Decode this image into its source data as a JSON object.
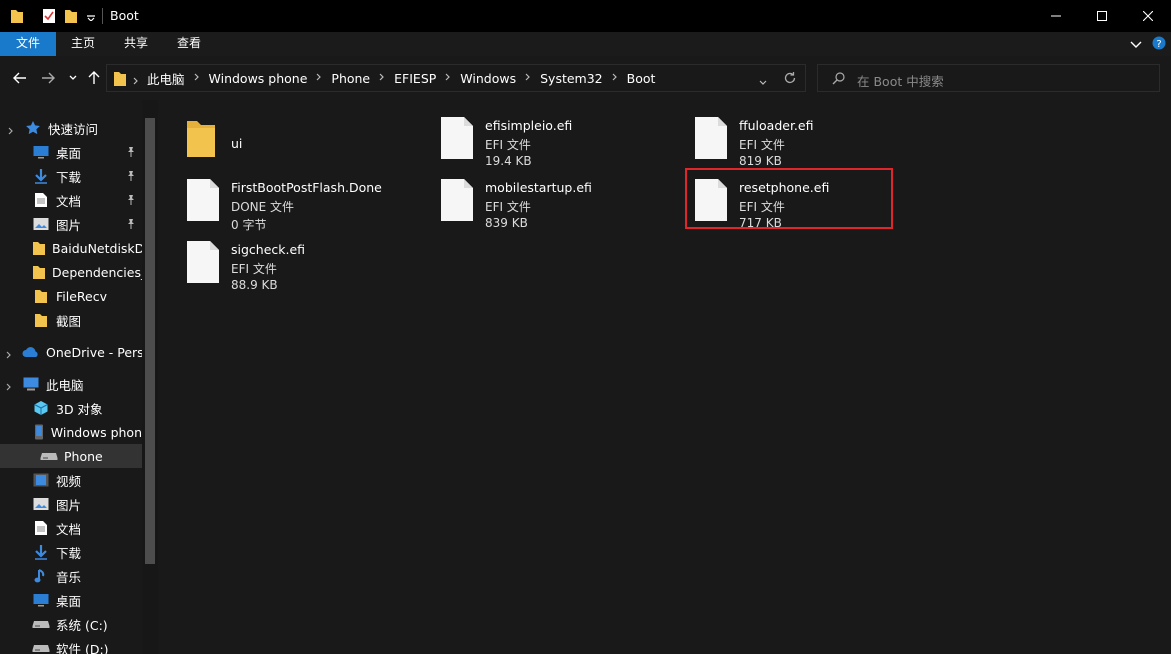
{
  "window": {
    "title": "Boot"
  },
  "ribbon": {
    "tabs": [
      "文件",
      "主页",
      "共享",
      "查看"
    ]
  },
  "address": {
    "crumbs": [
      "此电脑",
      "Windows phone",
      "Phone",
      "EFIESP",
      "Windows",
      "System32",
      "Boot"
    ]
  },
  "search": {
    "placeholder": "在 Boot 中搜索"
  },
  "sidebar": {
    "items": [
      {
        "label": "快速访问",
        "icon": "star-icon"
      },
      {
        "label": "桌面",
        "icon": "desktop-icon",
        "pinned": true
      },
      {
        "label": "下载",
        "icon": "download-icon",
        "pinned": true
      },
      {
        "label": "文档",
        "icon": "document-icon",
        "pinned": true
      },
      {
        "label": "图片",
        "icon": "picture-icon",
        "pinned": true
      },
      {
        "label": "BaiduNetdiskD",
        "icon": "folder-icon"
      },
      {
        "label": "Dependencies_",
        "icon": "folder-icon"
      },
      {
        "label": "FileRecv",
        "icon": "folder-icon"
      },
      {
        "label": "截图",
        "icon": "folder-icon"
      },
      {
        "label": "OneDrive - Perso",
        "icon": "cloud-icon"
      },
      {
        "label": "此电脑",
        "icon": "computer-icon"
      },
      {
        "label": "3D 对象",
        "icon": "cube-icon"
      },
      {
        "label": "Windows phon",
        "icon": "phone-icon"
      },
      {
        "label": "Phone",
        "icon": "drive-icon",
        "selected": true
      },
      {
        "label": "视频",
        "icon": "video-icon"
      },
      {
        "label": "图片",
        "icon": "picture-icon"
      },
      {
        "label": "文档",
        "icon": "document-icon"
      },
      {
        "label": "下载",
        "icon": "download-icon"
      },
      {
        "label": "音乐",
        "icon": "music-icon"
      },
      {
        "label": "桌面",
        "icon": "desktop-icon"
      },
      {
        "label": "系统 (C:)",
        "icon": "drive-icon"
      },
      {
        "label": "软件 (D:)",
        "icon": "drive-icon"
      }
    ]
  },
  "files": [
    {
      "name": "ui",
      "type": "",
      "size": "",
      "icon": "folder-icon"
    },
    {
      "name": "efisimpleio.efi",
      "type": "EFI 文件",
      "size": "19.4 KB",
      "icon": "file-icon"
    },
    {
      "name": "ffuloader.efi",
      "type": "EFI 文件",
      "size": "819 KB",
      "icon": "file-icon"
    },
    {
      "name": "FirstBootPostFlash.Done",
      "type": "DONE 文件",
      "size": "0 字节",
      "icon": "file-icon"
    },
    {
      "name": "mobilestartup.efi",
      "type": "EFI 文件",
      "size": "839 KB",
      "icon": "file-icon"
    },
    {
      "name": "resetphone.efi",
      "type": "EFI 文件",
      "size": "717 KB",
      "icon": "file-icon",
      "highlighted": true
    },
    {
      "name": "sigcheck.efi",
      "type": "EFI 文件",
      "size": "88.9 KB",
      "icon": "file-icon"
    }
  ],
  "colors": {
    "accent": "#1979ca",
    "highlight": "#e0262b",
    "background": "#191919"
  }
}
